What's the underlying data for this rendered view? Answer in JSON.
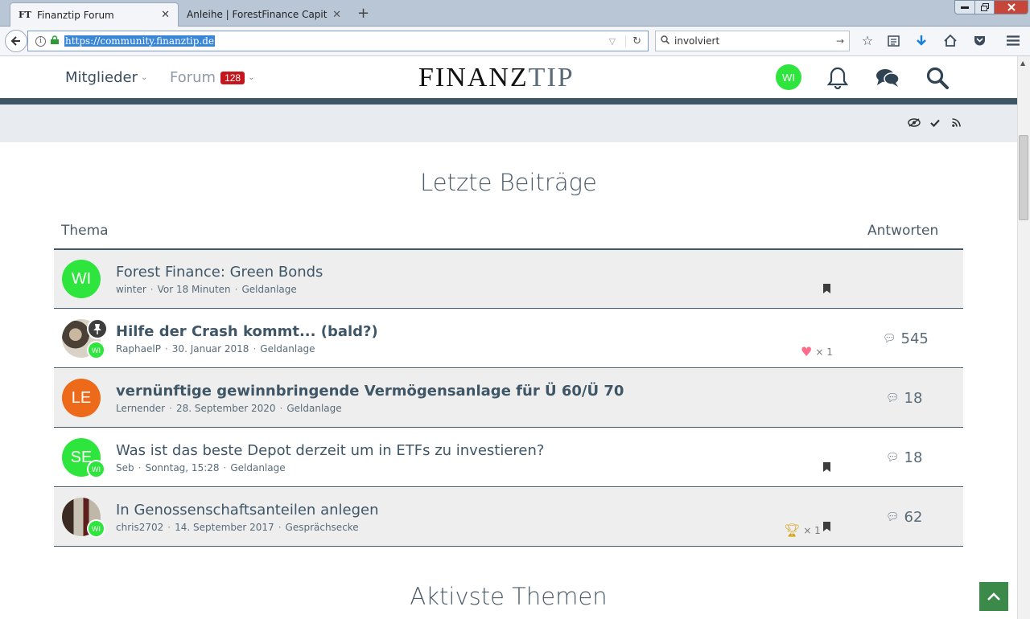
{
  "browser": {
    "tabs": [
      {
        "favicon": "FT",
        "title": "Finanztip Forum",
        "close": "✕"
      },
      {
        "title": "Anleihe | ForestFinance Capital",
        "close": "✕"
      }
    ],
    "new_tab": "+",
    "url": "https://community.finanztip.de",
    "search_value": "involviert"
  },
  "header": {
    "members_label": "Mitglieder",
    "forum_label": "Forum",
    "forum_count": "128",
    "logo_main": "FINANZ",
    "logo_accent": "TIP",
    "user_initials": "WI"
  },
  "latest": {
    "title": "Letzte Beiträge",
    "col_topic": "Thema",
    "col_replies": "Antworten",
    "threads": [
      {
        "initials": "WI",
        "title": "Forest Finance: Green Bonds",
        "author": "winter",
        "time": "Vor 18 Minuten",
        "category": "Geldanlage",
        "replies": ""
      },
      {
        "initials": "",
        "badge": "WI",
        "title": "Hilfe der Crash kommt... (bald?)",
        "author": "RaphaelP",
        "time": "30. Januar 2018",
        "category": "Geldanlage",
        "reaction": "× 1",
        "replies": "545"
      },
      {
        "initials": "LE",
        "title": "vernünftige gewinnbringende Vermögensanlage für Ü 60/Ü 70",
        "author": "Lernender",
        "time": "28. September 2020",
        "category": "Geldanlage",
        "replies": "18"
      },
      {
        "initials": "SE",
        "badge": "WI",
        "title": "Was ist das beste Depot derzeit um in ETFs zu investieren?",
        "author": "Seb",
        "time": "Sonntag, 15:28",
        "category": "Geldanlage",
        "replies": "18"
      },
      {
        "initials": "",
        "badge": "WI",
        "title": "In Genossenschaftsanteilen anlegen",
        "author": "chris2702",
        "time": "14. September 2017",
        "category": "Gesprächsecke",
        "reaction": "× 1",
        "replies": "62"
      }
    ]
  },
  "active": {
    "title": "Aktivste Themen"
  },
  "colors": {
    "accent_dark": "#3f5666",
    "avatar_green": "#2ee53d",
    "avatar_orange": "#ec6a1a",
    "badge_red": "#c4161c"
  }
}
